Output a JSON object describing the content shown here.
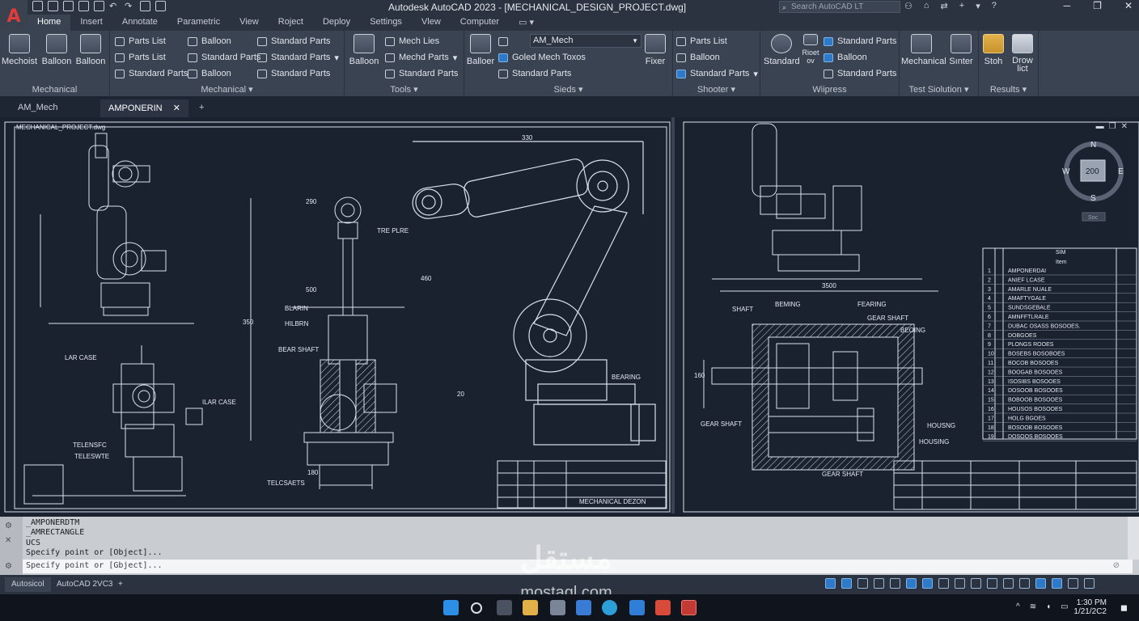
{
  "window": {
    "title": "Autodesk AutoCAD 2023 - [MECHANICAL_DESIGN_PROJECT.dwg]",
    "search_placeholder": "Search AutoCAD LT",
    "app_letter": "A"
  },
  "ribbon_tabs": [
    "Home",
    "Insert",
    "Annotate",
    "Parametric",
    "View",
    "Roject",
    "Deploy",
    "Settings",
    "Vlew",
    "Computer"
  ],
  "ribbon": {
    "mechanical": {
      "title": "Mechanical",
      "b1": "Mechoist",
      "b2": "Balloon",
      "b3": "Balloon"
    },
    "mechanical2": {
      "title": "Mechanical",
      "s1": "Parts List",
      "s2": "Parts List",
      "s3": "Standard Parts",
      "s4": "Balloon",
      "s5": "Standard Parts",
      "s6": "Balloon",
      "s7": "Standard Parts",
      "s8": "Standard Parts",
      "s9": "Standard Parts"
    },
    "tools": {
      "title": "Tools",
      "b1": "Balloon",
      "s1": "Mech Lies",
      "s2": "Mechd Parts",
      "s3": "Standard Parts"
    },
    "sieds": {
      "title": "Sieds",
      "b1": "Balloer",
      "combo": "AM_Mech",
      "s1": "Goled Mech Toxos",
      "s2": "Standard Parts",
      "b2": "Fixer"
    },
    "shooter": {
      "title": "Shooter",
      "s1": "Parts List",
      "s2": "Balloon",
      "s3": "Standard Parts"
    },
    "wiipress": {
      "title": "Wiipress",
      "b1": "Standard",
      "b2": "Rioet ov",
      "s1": "Standard Parts",
      "s2": "Balloon",
      "s3": "Standard Parts"
    },
    "test": {
      "title": "Test Siolution",
      "b1": "Mechanical",
      "b2": "Sınter"
    },
    "results": {
      "title": "Results",
      "b1": "Stoh",
      "b2": "Drow lict"
    }
  },
  "doc_tabs": [
    "AM_Mech",
    "AMPONERIN"
  ],
  "drawing": {
    "file_label": "MECHANICAL_PROJECT.dwg",
    "title_block_text": "MECHANICAL DEZON",
    "labels": [
      "LAR CASE",
      "TELENSFC",
      "TELESWTE",
      "ILAR CASE",
      "TELCSAETS",
      "TRE PLRE",
      "BLARIN",
      "HILBRN",
      "BEAR SHAFT",
      "BEARING",
      "SHAFT",
      "BEMING",
      "FEARING",
      "GEAR SHAFT",
      "BEOING",
      "GEAR SHAFT",
      "HOUSNG",
      "HOUSING",
      "GEAR SHAFT"
    ],
    "dims": [
      "330",
      "290",
      "460",
      "500",
      "350",
      "180",
      "20",
      "3500",
      "160"
    ],
    "compass": {
      "n": "N",
      "s": "S",
      "e": "E",
      "w": "W",
      "center": "200",
      "unit": "Soc"
    },
    "bom_header": [
      "SIM",
      "Item"
    ],
    "bom_rows": [
      [
        "1",
        "AMPONERDAI"
      ],
      [
        "2",
        "ANIEF LCASE"
      ],
      [
        "3",
        "AMARLE NUALE"
      ],
      [
        "4",
        "AMAFTYGALE"
      ],
      [
        "5",
        "SUNDSGEBALE"
      ],
      [
        "6",
        "AMNFFTLRALE"
      ],
      [
        "7",
        "DUBAC OSASS BOSOOES."
      ],
      [
        "8",
        "DOBGOES"
      ],
      [
        "9",
        "PLONGS ROOES"
      ],
      [
        "10",
        "BOSEBS BOSOBOES"
      ],
      [
        "11",
        "BOCOB BOSOOES"
      ],
      [
        "12",
        "BOOGAB BOSOOES"
      ],
      [
        "13",
        "ISOSIBS BOSOOES"
      ],
      [
        "14",
        "DOSOOB BOSOOES"
      ],
      [
        "15",
        "BOBOOB BOSOOES"
      ],
      [
        "16",
        "HOUSOS BOSOOES"
      ],
      [
        "17",
        "HOLG BGOES"
      ],
      [
        "18",
        "BOSOOB BOSOOES"
      ],
      [
        "19",
        "DOSOOS BOSOOES"
      ]
    ]
  },
  "command": {
    "history": [
      "_AMPONERDTM",
      "_AMRECTANGLE",
      "UCS",
      "Specify point or [Object]..."
    ],
    "prompt": "Specify point or [Gbject]..."
  },
  "status_tabs": [
    "Autosicol",
    "AutoCAD 2VC3"
  ],
  "taskbar": {
    "time": "1:30 PM",
    "date": "1/21/2C2"
  },
  "watermark": {
    "arabic": "مستقل",
    "latin": "mostaql.com"
  }
}
